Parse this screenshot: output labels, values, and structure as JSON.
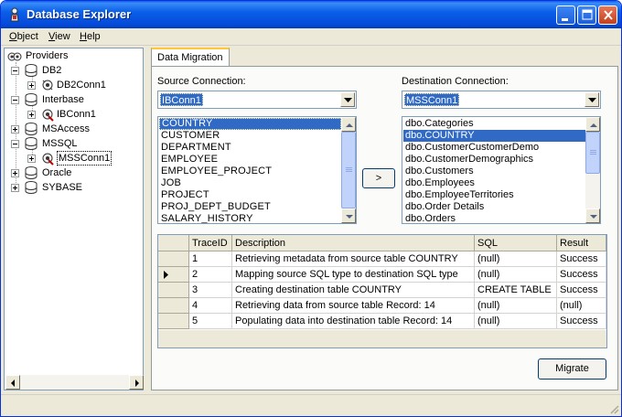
{
  "window": {
    "title": "Database Explorer",
    "accent": "#0a5fe8"
  },
  "menu": {
    "items": [
      {
        "label": "Object",
        "mnemonic": "O"
      },
      {
        "label": "View",
        "mnemonic": "V"
      },
      {
        "label": "Help",
        "mnemonic": "H"
      }
    ]
  },
  "tree": {
    "root": "Providers",
    "nodes": [
      {
        "label": "DB2",
        "expanded": true,
        "children": [
          {
            "label": "DB2Conn1"
          }
        ]
      },
      {
        "label": "Interbase",
        "expanded": true,
        "children": [
          {
            "label": "IBConn1"
          }
        ]
      },
      {
        "label": "MSAccess",
        "expanded": false
      },
      {
        "label": "MSSQL",
        "expanded": true,
        "children": [
          {
            "label": "MSSConn1",
            "selected": true
          }
        ]
      },
      {
        "label": "Oracle",
        "expanded": false
      },
      {
        "label": "SYBASE",
        "expanded": false
      }
    ]
  },
  "tab": {
    "label": "Data Migration"
  },
  "source": {
    "label": "Source Connection:",
    "selected": "IBConn1",
    "tables": [
      "COUNTRY",
      "CUSTOMER",
      "DEPARTMENT",
      "EMPLOYEE",
      "EMPLOYEE_PROJECT",
      "JOB",
      "PROJECT",
      "PROJ_DEPT_BUDGET",
      "SALARY_HISTORY"
    ],
    "selected_index": 0
  },
  "destination": {
    "label": "Destination Connection:",
    "selected": "MSSConn1",
    "tables": [
      "dbo.Categories",
      "dbo.COUNTRY",
      "dbo.CustomerCustomerDemo",
      "dbo.CustomerDemographics",
      "dbo.Customers",
      "dbo.Employees",
      "dbo.EmployeeTerritories",
      "dbo.Order Details",
      "dbo.Orders"
    ],
    "selected_index": 1
  },
  "transfer_button": {
    "label": ">"
  },
  "grid": {
    "columns": [
      "TraceID",
      "Description",
      "SQL",
      "Result"
    ],
    "rows": [
      {
        "id": "1",
        "description": "Retrieving metadata from source table COUNTRY",
        "sql": "(null)",
        "result": "Success"
      },
      {
        "id": "2",
        "description": "Mapping source SQL type to destination SQL type",
        "sql": "(null)",
        "result": "Success"
      },
      {
        "id": "3",
        "description": "Creating destination table COUNTRY",
        "sql": "CREATE TABLE",
        "result": "Success"
      },
      {
        "id": "4",
        "description": "Retrieving data from source table Record: 14",
        "sql": "(null)",
        "result": "(null)"
      },
      {
        "id": "5",
        "description": "Populating data into destination table Record: 14",
        "sql": "(null)",
        "result": "Success"
      }
    ],
    "current_row": 1
  },
  "migrate_button": {
    "label": "Migrate"
  }
}
